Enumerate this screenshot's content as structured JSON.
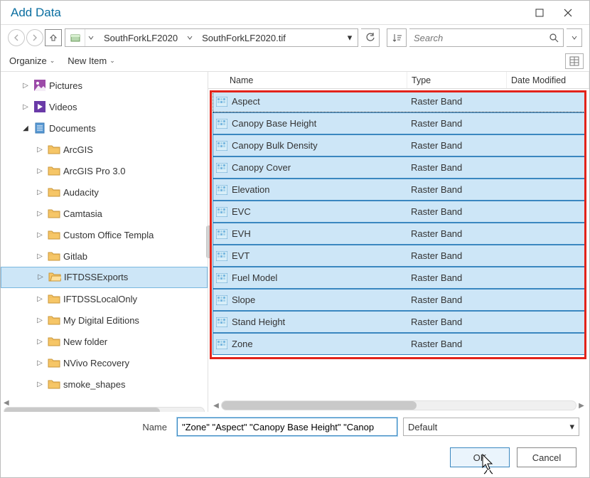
{
  "title": "Add Data",
  "breadcrumb": {
    "segment1": "SouthForkLF2020",
    "file": "SouthForkLF2020.tif"
  },
  "search": {
    "placeholder": "Search"
  },
  "orgbar": {
    "organize": "Organize",
    "newitem": "New Item"
  },
  "columns": {
    "name": "Name",
    "type": "Type",
    "date": "Date Modified"
  },
  "tree": {
    "pictures": "Pictures",
    "videos": "Videos",
    "documents": "Documents",
    "arcgis": "ArcGIS",
    "arcgispro": "ArcGIS Pro 3.0",
    "audacity": "Audacity",
    "camtasia": "Camtasia",
    "customoffice": "Custom Office Templa",
    "gitlab": "Gitlab",
    "iftdssexports": "IFTDSSExports",
    "iftdsslocal": "IFTDSSLocalOnly",
    "mydigital": "My Digital Editions",
    "newfolder": "New folder",
    "nvivo": "NVivo Recovery",
    "smoke": "smoke_shapes"
  },
  "items": [
    {
      "name": "Aspect",
      "type": "Raster Band"
    },
    {
      "name": "Canopy Base Height",
      "type": "Raster Band"
    },
    {
      "name": "Canopy Bulk Density",
      "type": "Raster Band"
    },
    {
      "name": "Canopy Cover",
      "type": "Raster Band"
    },
    {
      "name": "Elevation",
      "type": "Raster Band"
    },
    {
      "name": "EVC",
      "type": "Raster Band"
    },
    {
      "name": "EVH",
      "type": "Raster Band"
    },
    {
      "name": "EVT",
      "type": "Raster Band"
    },
    {
      "name": "Fuel Model",
      "type": "Raster Band"
    },
    {
      "name": "Slope",
      "type": "Raster Band"
    },
    {
      "name": "Stand Height",
      "type": "Raster Band"
    },
    {
      "name": "Zone",
      "type": "Raster Band"
    }
  ],
  "form": {
    "name_label": "Name",
    "name_value": "\"Zone\" \"Aspect\" \"Canopy Base Height\" \"Canop",
    "type_value": "Default"
  },
  "buttons": {
    "ok": "OK",
    "cancel": "Cancel"
  }
}
